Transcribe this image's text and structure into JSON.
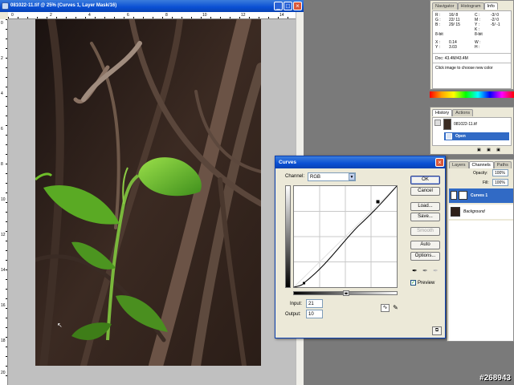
{
  "document": {
    "title": "081022-11.tif @ 25% (Curves 1, Layer Mask/16)",
    "ruler_top_numbers": [
      "0",
      "2",
      "4",
      "6",
      "8",
      "10",
      "12",
      "14"
    ],
    "ruler_left_numbers": [
      "0",
      "2",
      "4",
      "6",
      "8",
      "10",
      "12",
      "14",
      "16",
      "18",
      "20",
      "22"
    ]
  },
  "info_panel": {
    "tabs": [
      "Navigator",
      "Histogram",
      "Info"
    ],
    "active_tab": "Info",
    "rgb_labels": [
      "R :",
      "G :",
      "B :"
    ],
    "rgb_values": [
      "16/ 8",
      "22/ 11",
      "29/ 15"
    ],
    "cmyk_labels": [
      "C :",
      "M :",
      "Y :",
      "K :"
    ],
    "cmyk_values": [
      "-3/ 0",
      "-2/ 0",
      "-5/ -1",
      ""
    ],
    "bit_left": "8-bit",
    "bit_right": "8-bit",
    "xy_labels": [
      "X :",
      "Y :"
    ],
    "xy_values": [
      "0.14",
      "3.03"
    ],
    "wh_labels": [
      "W :",
      "H :"
    ],
    "doc_size": "Doc: 43.4M/43.4M",
    "hint": "Click image to choose new color"
  },
  "history_panel": {
    "tabs": [
      "History",
      "Actions"
    ],
    "active_tab": "History",
    "snapshot_name": "081022-11.tif",
    "state_name": "Open"
  },
  "layers_panel": {
    "tabs": [
      "Layers",
      "Channels",
      "Paths"
    ],
    "active_tab": "Channels",
    "opacity_label": "Opacity:",
    "opacity_value": "100%",
    "fill_label": "Fill:",
    "fill_value": "100%",
    "layers": [
      {
        "name": "Curves 1",
        "selected": true
      },
      {
        "name": "Background",
        "selected": false
      }
    ]
  },
  "curves_dialog": {
    "title": "Curves",
    "channel_label": "Channel:",
    "channel_value": "RGB",
    "buttons": {
      "ok": "OK",
      "cancel": "Cancel",
      "load": "Load...",
      "save": "Save...",
      "smooth": "Smooth",
      "auto": "Auto",
      "options": "Options..."
    },
    "input_label": "Input:",
    "input_value": "21",
    "output_label": "Output:",
    "output_value": "10",
    "preview_label": "Preview",
    "preview_checked": true
  },
  "watermark": "#268943",
  "colors": {
    "titlebar": "#0a4fd4",
    "selection": "#316ac5",
    "dialog_bg": "#ece9d8",
    "leaf_green": "#6cc22e"
  }
}
